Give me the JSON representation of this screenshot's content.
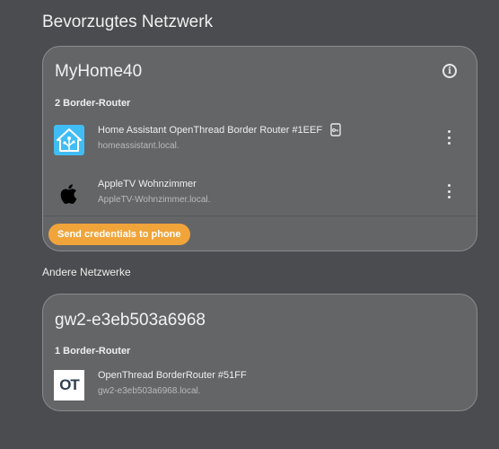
{
  "preferred": {
    "heading": "Bevorzugtes Netzwerk",
    "network": {
      "name": "MyHome40",
      "router_count": "2 Border-Router",
      "routers": [
        {
          "name": "Home Assistant OpenThread Border Router #1EEF",
          "host": "homeassistant.local.",
          "icon": "home-assistant-icon"
        },
        {
          "name": "AppleTV Wohnzimmer",
          "host": "AppleTV-Wohnzimmer.local.",
          "icon": "apple-icon"
        }
      ],
      "send_button": "Send credentials to phone"
    }
  },
  "other": {
    "heading": "Andere Netzwerke",
    "networks": [
      {
        "name": "gw2-e3eb503a6968",
        "router_count": "1 Border-Router",
        "routers": [
          {
            "name": "OpenThread BorderRouter #51FF",
            "host": "gw2-e3eb503a6968.local.",
            "icon": "openthread-icon",
            "icon_text": "OT"
          }
        ]
      }
    ]
  },
  "colors": {
    "accent": "#f0a43a",
    "ha_blue": "#41bdf5",
    "background": "#4b4c4f",
    "card": "#646567"
  }
}
